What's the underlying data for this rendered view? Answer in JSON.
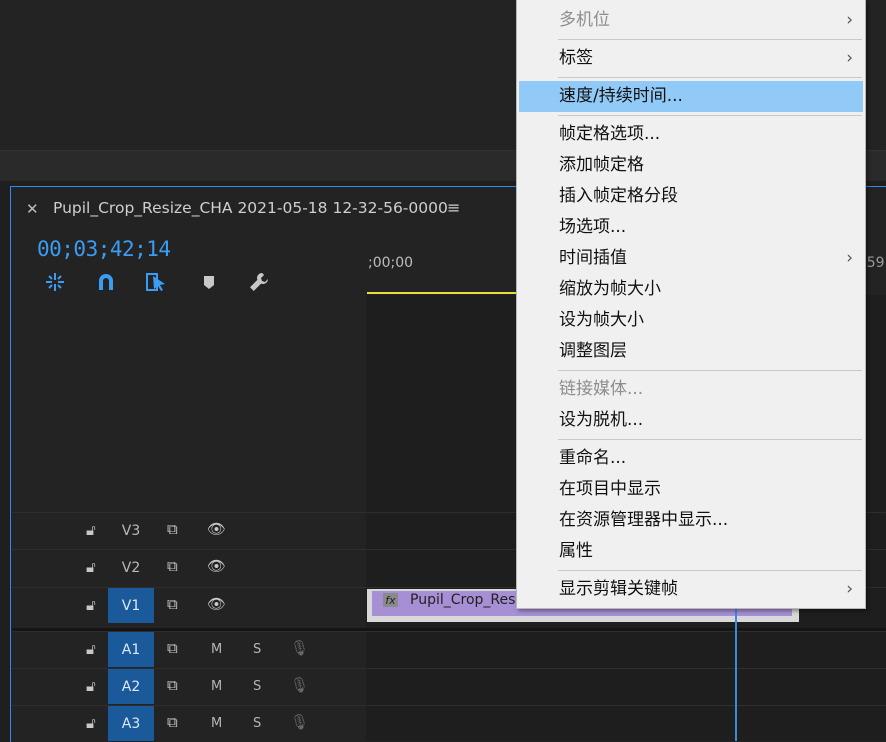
{
  "sequence": {
    "title": "Pupil_Crop_Resize_CHA 2021-05-18 12-32-56-0000",
    "timecode": "00;03;42;14",
    "ruler_start": ";00;00",
    "ruler_end": ";59"
  },
  "tools": [
    {
      "icon": "insert-overwrite-icon"
    },
    {
      "icon": "snap-magnet-icon"
    },
    {
      "icon": "linked-selection-icon"
    },
    {
      "icon": "add-marker-icon"
    },
    {
      "icon": "timeline-settings-wrench-icon"
    }
  ],
  "video_tracks": [
    {
      "label": "V3",
      "active": false
    },
    {
      "label": "V2",
      "active": false
    },
    {
      "label": "V1",
      "active": true
    }
  ],
  "audio_tracks": [
    {
      "label": "A1",
      "m": "M",
      "s": "S"
    },
    {
      "label": "A2",
      "m": "M",
      "s": "S"
    },
    {
      "label": "A3",
      "m": "M",
      "s": "S"
    }
  ],
  "clip": {
    "fx_badge": "fx",
    "label": "Pupil_Crop_Resize_CHA 2021-05-18 12-32-56-0000"
  },
  "context_menu": {
    "items": [
      {
        "label": "多机位",
        "disabled": true,
        "submenu": true
      },
      {
        "label": "标签",
        "disabled": false,
        "submenu": true
      },
      {
        "label": "速度/持续时间...",
        "disabled": false,
        "highlighted": true
      },
      {
        "label": "帧定格选项...",
        "disabled": false
      },
      {
        "label": "添加帧定格",
        "disabled": false
      },
      {
        "label": "插入帧定格分段",
        "disabled": false
      },
      {
        "label": "场选项...",
        "disabled": false
      },
      {
        "label": "时间插值",
        "disabled": false,
        "submenu": true
      },
      {
        "label": "缩放为帧大小",
        "disabled": false
      },
      {
        "label": "设为帧大小",
        "disabled": false
      },
      {
        "label": "调整图层",
        "disabled": false
      },
      {
        "label": "链接媒体...",
        "disabled": true
      },
      {
        "label": "设为脱机...",
        "disabled": false
      },
      {
        "label": "重命名...",
        "disabled": false
      },
      {
        "label": "在项目中显示",
        "disabled": false
      },
      {
        "label": "在资源管理器中显示...",
        "disabled": false
      },
      {
        "label": "属性",
        "disabled": false
      },
      {
        "label": "显示剪辑关键帧",
        "disabled": false,
        "submenu": true
      }
    ],
    "submenu_arrow": "›"
  },
  "colors": {
    "accent": "#2d8ceb",
    "timecode": "#3a9cf2",
    "clip": "#a78fd6",
    "highlight": "#91c9f7",
    "track_active": "#1a5a9a"
  }
}
